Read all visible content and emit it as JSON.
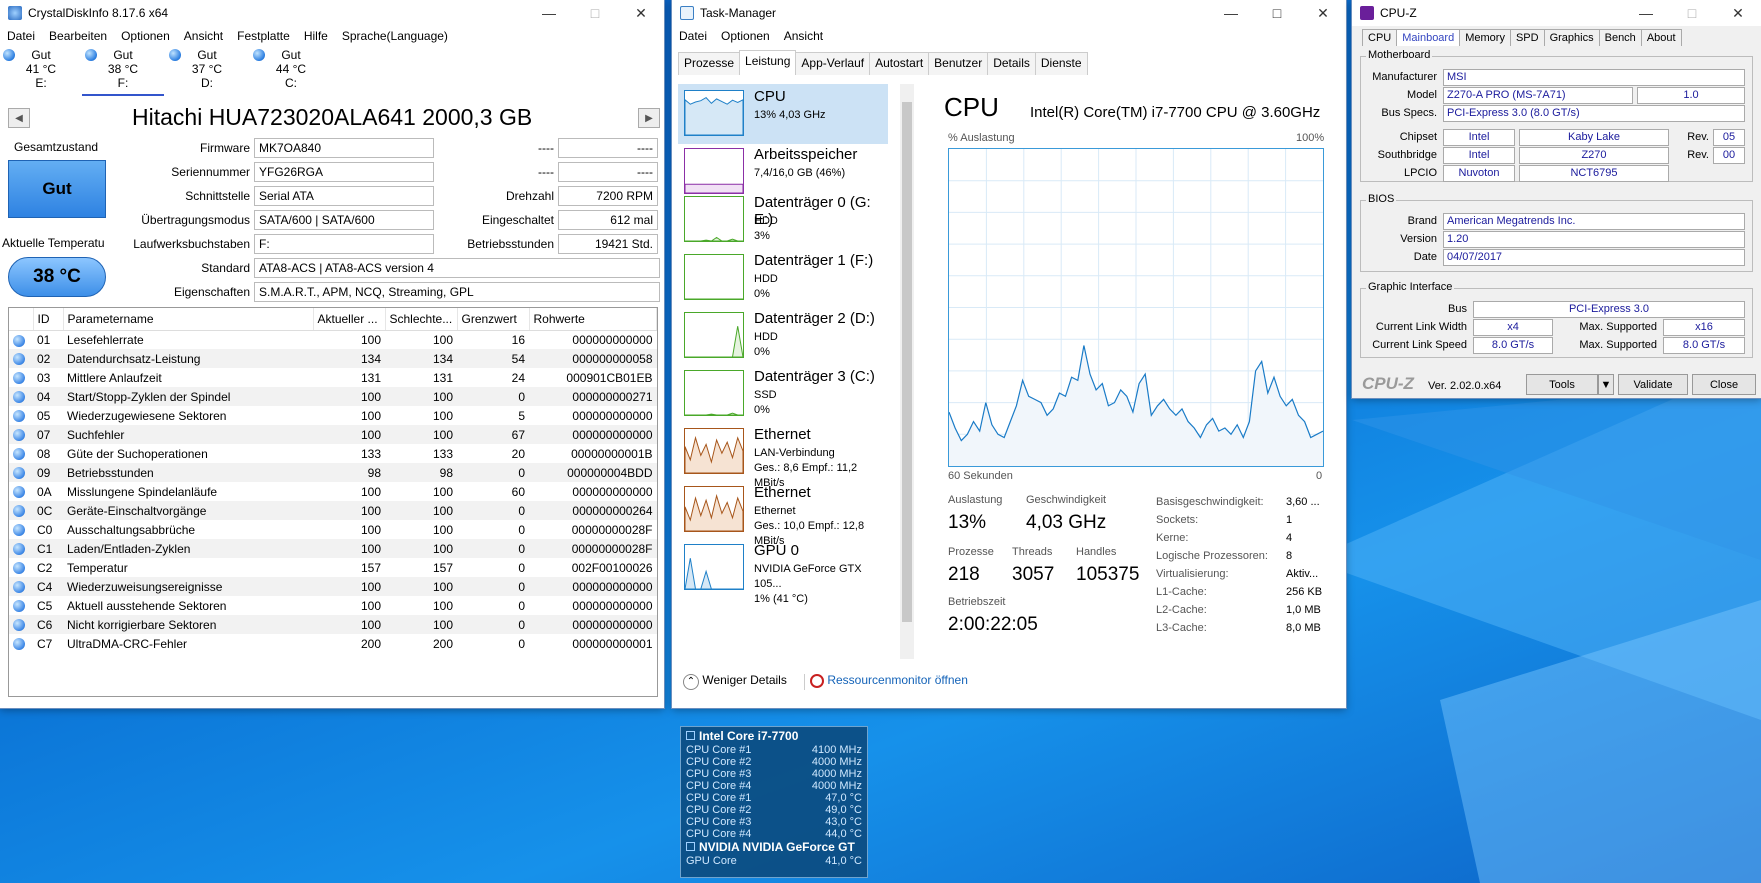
{
  "cdi": {
    "title": "CrystalDiskInfo 8.17.6 x64",
    "menu": [
      "Datei",
      "Bearbeiten",
      "Optionen",
      "Ansicht",
      "Festplatte",
      "Hilfe",
      "Sprache(Language)"
    ],
    "drives": [
      {
        "status": "Gut",
        "temp": "41 °C",
        "letter": "E:"
      },
      {
        "status": "Gut",
        "temp": "38 °C",
        "letter": "F:"
      },
      {
        "status": "Gut",
        "temp": "37 °C",
        "letter": "D:"
      },
      {
        "status": "Gut",
        "temp": "44 °C",
        "letter": "C:"
      }
    ],
    "disk_title": "Hitachi HUA723020ALA641 2000,3 GB",
    "health_label": "Gesamtzustand",
    "health_value": "Gut",
    "temp_label": "Aktuelle Temperatu",
    "temp_value": "38 °C",
    "info": {
      "firmware_label": "Firmware",
      "firmware": "MK7OA840",
      "serial_label": "Seriennummer",
      "serial": "YFG26RGA",
      "interface_label": "Schnittstelle",
      "interface": "Serial ATA",
      "transfer_label": "Übertragungsmodus",
      "transfer": "SATA/600 | SATA/600",
      "letters_label": "Laufwerksbuchstaben",
      "letters": "F:",
      "standard_label": "Standard",
      "standard": "ATA8-ACS | ATA8-ACS version 4",
      "features_label": "Eigenschaften",
      "features": "S.M.A.R.T., APM, NCQ, Streaming, GPL",
      "blank1": "----",
      "blank1v": "----",
      "blank2": "----",
      "blank2v": "----",
      "rpm_label": "Drehzahl",
      "rpm": "7200 RPM",
      "poweron_label": "Eingeschaltet",
      "poweron": "612 mal",
      "hours_label": "Betriebsstunden",
      "hours": "19421 Std."
    },
    "smart_headers": [
      "ID",
      "Parametername",
      "Aktueller ...",
      "Schlechte...",
      "Grenzwert",
      "Rohwerte"
    ],
    "smart_rows": [
      [
        "01",
        "Lesefehlerrate",
        "100",
        "100",
        "16",
        "000000000000"
      ],
      [
        "02",
        "Datendurchsatz-Leistung",
        "134",
        "134",
        "54",
        "000000000058"
      ],
      [
        "03",
        "Mittlere Anlaufzeit",
        "131",
        "131",
        "24",
        "000901CB01EB"
      ],
      [
        "04",
        "Start/Stopp-Zyklen der Spindel",
        "100",
        "100",
        "0",
        "000000000271"
      ],
      [
        "05",
        "Wiederzugewiesene Sektoren",
        "100",
        "100",
        "5",
        "000000000000"
      ],
      [
        "07",
        "Suchfehler",
        "100",
        "100",
        "67",
        "000000000000"
      ],
      [
        "08",
        "Güte der Suchoperationen",
        "133",
        "133",
        "20",
        "00000000001B"
      ],
      [
        "09",
        "Betriebsstunden",
        "98",
        "98",
        "0",
        "000000004BDD"
      ],
      [
        "0A",
        "Misslungene Spindelanläufe",
        "100",
        "100",
        "60",
        "000000000000"
      ],
      [
        "0C",
        "Geräte-Einschaltvorgänge",
        "100",
        "100",
        "0",
        "000000000264"
      ],
      [
        "C0",
        "Ausschaltungsabbrüche",
        "100",
        "100",
        "0",
        "00000000028F"
      ],
      [
        "C1",
        "Laden/Entladen-Zyklen",
        "100",
        "100",
        "0",
        "00000000028F"
      ],
      [
        "C2",
        "Temperatur",
        "157",
        "157",
        "0",
        "002F00100026"
      ],
      [
        "C4",
        "Wiederzuweisungsereignisse",
        "100",
        "100",
        "0",
        "000000000000"
      ],
      [
        "C5",
        "Aktuell ausstehende Sektoren",
        "100",
        "100",
        "0",
        "000000000000"
      ],
      [
        "C6",
        "Nicht korrigierbare Sektoren",
        "100",
        "100",
        "0",
        "000000000000"
      ],
      [
        "C7",
        "UltraDMA-CRC-Fehler",
        "200",
        "200",
        "0",
        "000000000001"
      ]
    ]
  },
  "tm": {
    "title": "Task-Manager",
    "menu": [
      "Datei",
      "Optionen",
      "Ansicht"
    ],
    "tabs": [
      "Prozesse",
      "Leistung",
      "App-Verlauf",
      "Autostart",
      "Benutzer",
      "Details",
      "Dienste"
    ],
    "sidebar": [
      {
        "name": "CPU",
        "l1": "13% 4,03 GHz",
        "l2": ""
      },
      {
        "name": "Arbeitsspeicher",
        "l1": "7,4/16,0 GB (46%)",
        "l2": ""
      },
      {
        "name": "Datenträger 0 (G: E:)",
        "l1": "HDD",
        "l2": "3%"
      },
      {
        "name": "Datenträger 1 (F:)",
        "l1": "HDD",
        "l2": "0%"
      },
      {
        "name": "Datenträger 2 (D:)",
        "l1": "HDD",
        "l2": "0%"
      },
      {
        "name": "Datenträger 3 (C:)",
        "l1": "SSD",
        "l2": "0%"
      },
      {
        "name": "Ethernet",
        "l1": "LAN-Verbindung",
        "l2": "Ges.: 8,6 Empf.: 11,2 MBit/s"
      },
      {
        "name": "Ethernet",
        "l1": "Ethernet",
        "l2": "Ges.: 10,0 Empf.: 12,8 MBit/s"
      },
      {
        "name": "GPU 0",
        "l1": "NVIDIA GeForce GTX 105...",
        "l2": "1% (41 °C)"
      }
    ],
    "cpu_title": "CPU",
    "cpu_model": "Intel(R) Core(TM) i7-7700 CPU @ 3.60GHz",
    "graph_label": "% Auslastung",
    "graph_max": "100%",
    "graph_time": "60 Sekunden",
    "graph_zero": "0",
    "chart_data": {
      "type": "area",
      "ylim": [
        0,
        100
      ],
      "values": [
        17,
        12,
        8,
        10,
        14,
        11,
        20,
        13,
        10,
        9,
        14,
        19,
        27,
        22,
        21,
        20,
        16,
        18,
        23,
        22,
        28,
        27,
        38,
        29,
        24,
        26,
        19,
        20,
        24,
        22,
        17,
        26,
        29,
        16,
        19,
        21,
        18,
        16,
        18,
        14,
        12,
        9,
        13,
        15,
        11,
        12,
        10,
        13,
        9,
        14,
        30,
        33,
        23,
        28,
        22,
        19,
        21,
        16,
        14,
        9,
        10,
        11
      ]
    },
    "stats": {
      "util_label": "Auslastung",
      "util": "13%",
      "speed_label": "Geschwindigkeit",
      "speed": "4,03 GHz",
      "proc_label": "Prozesse",
      "proc": "218",
      "threads_label": "Threads",
      "threads": "3057",
      "handles_label": "Handles",
      "handles": "105375",
      "uptime_label": "Betriebszeit",
      "uptime": "2:00:22:05"
    },
    "specs": [
      [
        "Basisgeschwindigkeit:",
        "3,60 ..."
      ],
      [
        "Sockets:",
        "1"
      ],
      [
        "Kerne:",
        "4"
      ],
      [
        "Logische Prozessoren:",
        "8"
      ],
      [
        "Virtualisierung:",
        "Aktiv..."
      ],
      [
        "L1-Cache:",
        "256 KB"
      ],
      [
        "L2-Cache:",
        "1,0 MB"
      ],
      [
        "L3-Cache:",
        "8,0 MB"
      ]
    ],
    "less_details": "Weniger Details",
    "resmon": "Ressourcenmonitor öffnen"
  },
  "cpuz": {
    "title": "CPU-Z",
    "tabs": [
      "CPU",
      "Mainboard",
      "Memory",
      "SPD",
      "Graphics",
      "Bench",
      "About"
    ],
    "motherboard_title": "Motherboard",
    "manufacturer_label": "Manufacturer",
    "manufacturer": "MSI",
    "model_label": "Model",
    "model": "Z270-A PRO (MS-7A71)",
    "model_rev": "1.0",
    "bus_label": "Bus Specs.",
    "bus": "PCI-Express 3.0 (8.0 GT/s)",
    "chipset_label": "Chipset",
    "chipset_v": "Intel",
    "chipset_n": "Kaby Lake",
    "rev_label": "Rev.",
    "chipset_rev": "05",
    "south_label": "Southbridge",
    "south_v": "Intel",
    "south_n": "Z270",
    "south_rev": "00",
    "lpcio_label": "LPCIO",
    "lpcio_v": "Nuvoton",
    "lpcio_n": "NCT6795",
    "bios_title": "BIOS",
    "brand_label": "Brand",
    "brand": "American Megatrends Inc.",
    "version_label": "Version",
    "version": "1.20",
    "date_label": "Date",
    "date": "04/07/2017",
    "gi_title": "Graphic Interface",
    "gbus_label": "Bus",
    "gbus": "PCI-Express 3.0",
    "clw_label": "Current Link Width",
    "clw": "x4",
    "msw_label": "Max. Supported",
    "msw": "x16",
    "cls_label": "Current Link Speed",
    "cls": "8.0 GT/s",
    "mss_label": "Max. Supported",
    "mss": "8.0 GT/s",
    "brand_footer": "CPU-Z",
    "ver": "Ver. 2.02.0.x64",
    "tools": "Tools",
    "validate": "Validate",
    "close": "Close"
  },
  "widget": {
    "title": "Intel Core i7-7700",
    "rows": [
      [
        "CPU Core #1",
        "4100 MHz"
      ],
      [
        "CPU Core #2",
        "4000 MHz"
      ],
      [
        "CPU Core #3",
        "4000 MHz"
      ],
      [
        "CPU Core #4",
        "4000 MHz"
      ],
      [
        "CPU Core #1",
        "47,0 °C"
      ],
      [
        "CPU Core #2",
        "49,0 °C"
      ],
      [
        "CPU Core #3",
        "43,0 °C"
      ],
      [
        "CPU Core #4",
        "44,0 °C"
      ]
    ],
    "gpu_title": "NVIDIA NVIDIA GeForce GT",
    "gpu_label": "GPU Core",
    "gpu_value": "41,0 °C"
  }
}
